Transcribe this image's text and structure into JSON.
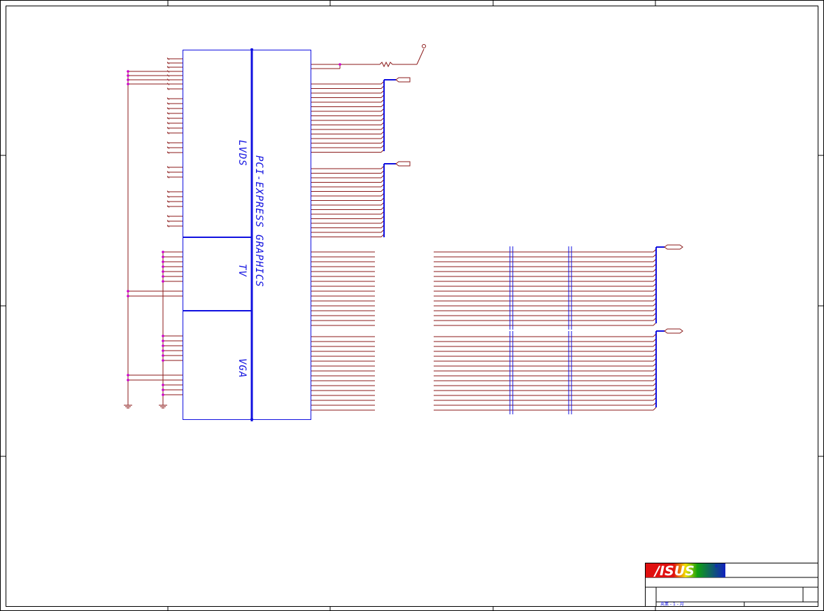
{
  "blocks": {
    "lvds": "LVDS",
    "tv": "TV",
    "vga": "VGA",
    "bus": "PCI-EXPRESS  GRAPHICS"
  },
  "title_block": {
    "logo": "/ISUS",
    "registered_mark": "®",
    "footer_text": "英業 - 1 - 月"
  },
  "colors": {
    "wire": "#8b1a1a",
    "bus": "#1010e0",
    "junction": "#cc00cc",
    "border": "#000000"
  },
  "icons": [
    "ground-icon",
    "resistor-icon",
    "off-page-connector-icon",
    "power-pin-icon"
  ]
}
